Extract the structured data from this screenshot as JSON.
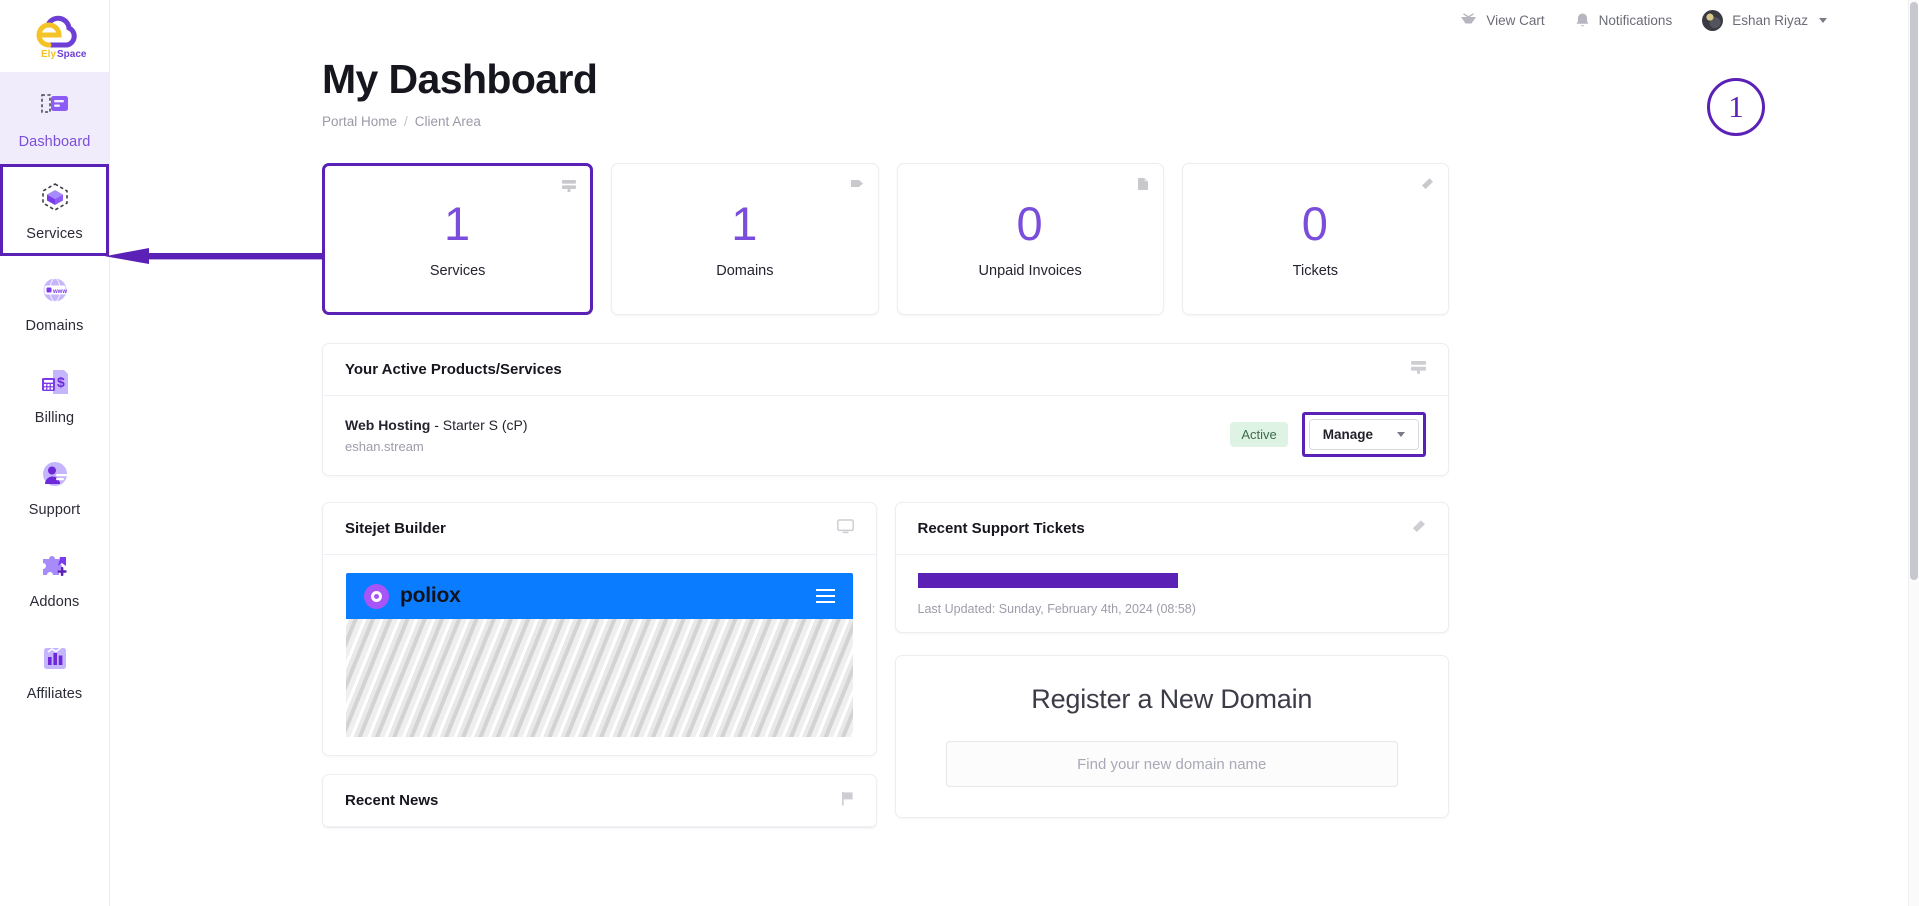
{
  "brand": {
    "name_part1": "Ely",
    "name_part2": "Space"
  },
  "topbar": {
    "view_cart": "View Cart",
    "notifications": "Notifications",
    "user_name": "Eshan Riyaz"
  },
  "sidebar": {
    "items": [
      {
        "label": "Dashboard",
        "icon": "dashboard-icon",
        "state": "active"
      },
      {
        "label": "Services",
        "icon": "services-cube-icon",
        "state": "highlighted"
      },
      {
        "label": "Domains",
        "icon": "domains-globe-icon",
        "state": "normal"
      },
      {
        "label": "Billing",
        "icon": "billing-invoice-icon",
        "state": "normal"
      },
      {
        "label": "Support",
        "icon": "support-agent-icon",
        "state": "normal"
      },
      {
        "label": "Addons",
        "icon": "addons-puzzle-icon",
        "state": "normal"
      },
      {
        "label": "Affiliates",
        "icon": "affiliates-chart-icon",
        "state": "normal"
      }
    ]
  },
  "page": {
    "title": "My Dashboard",
    "breadcrumb": {
      "home": "Portal Home",
      "separator": "/",
      "current": "Client Area"
    }
  },
  "stats": [
    {
      "value": "1",
      "label": "Services",
      "icon": "server-icon",
      "highlighted": true
    },
    {
      "value": "1",
      "label": "Domains",
      "icon": "tag-icon",
      "highlighted": false
    },
    {
      "value": "0",
      "label": "Unpaid Invoices",
      "icon": "file-icon",
      "highlighted": false
    },
    {
      "value": "0",
      "label": "Tickets",
      "icon": "ticket-icon",
      "highlighted": false
    }
  ],
  "products_panel": {
    "title": "Your Active Products/Services",
    "icon": "server-icon",
    "row": {
      "product_type": "Web Hosting",
      "product_plan": "- Starter S (cP)",
      "domain": "eshan.stream",
      "status": "Active",
      "manage_label": "Manage"
    }
  },
  "sitejet_panel": {
    "title": "Sitejet Builder",
    "icon": "monitor-icon",
    "preview": {
      "site_name": "poliox"
    }
  },
  "news_panel": {
    "title": "Recent News",
    "icon": "flag-icon"
  },
  "tickets_panel": {
    "title": "Recent Support Tickets",
    "icon": "ticket-icon",
    "last_updated": "Last Updated: Sunday, February 4th, 2024 (08:58)"
  },
  "domain_panel": {
    "title": "Register a New Domain",
    "search_placeholder": "Find your new domain name",
    "search_value": ""
  },
  "annotations": {
    "step_number": "1"
  },
  "colors": {
    "accent_purple": "#7b4ddb",
    "annotation_purple": "#5b21b6",
    "active_badge_bg": "#dff3e4",
    "site_blue": "#0a7cff"
  }
}
